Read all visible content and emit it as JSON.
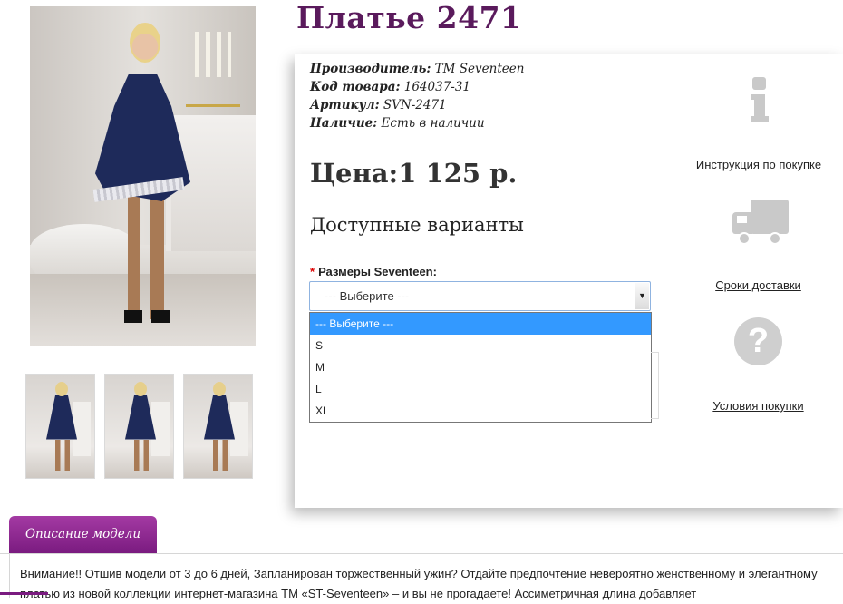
{
  "product": {
    "title": "Платье 2471",
    "specs": [
      {
        "label": "Производитель:",
        "value": "ТМ Seventeen"
      },
      {
        "label": "Код товара:",
        "value": "164037-31"
      },
      {
        "label": "Артикул:",
        "value": "SVN-2471"
      },
      {
        "label": "Наличие:",
        "value": "Есть в наличии"
      }
    ],
    "price": "Цена:1 125 р.",
    "variants_title": "Доступные варианты",
    "size_label": "Размеры Seventeen:",
    "required_mark": "*",
    "select": {
      "current": "--- Выберите ---",
      "options": [
        "--- Выберите ---",
        "S",
        "M",
        "L",
        "XL"
      ]
    }
  },
  "side_links": {
    "instructions": "Инструкция по покупке",
    "delivery": "Сроки доставки",
    "terms": "Условия покупки",
    "question_glyph": "?"
  },
  "icons": [
    "info-icon",
    "truck-icon",
    "question-icon",
    "chevron-down-icon"
  ],
  "description": {
    "tab_label": "Описание модели",
    "text": "Внимание!! Отшив модели от 3 до 6 дней, Запланирован торжественный ужин? Отдайте предпочтение невероятно женственному и элегантному платью из новой коллекции интернет-магазина ТМ «ST-Seventeen» – и вы не прогадаете! Ассиметричная длина добавляет"
  },
  "colors": {
    "title": "#5a1a5c",
    "tab": "#8a2a8e",
    "selected_option": "#3399ff"
  }
}
